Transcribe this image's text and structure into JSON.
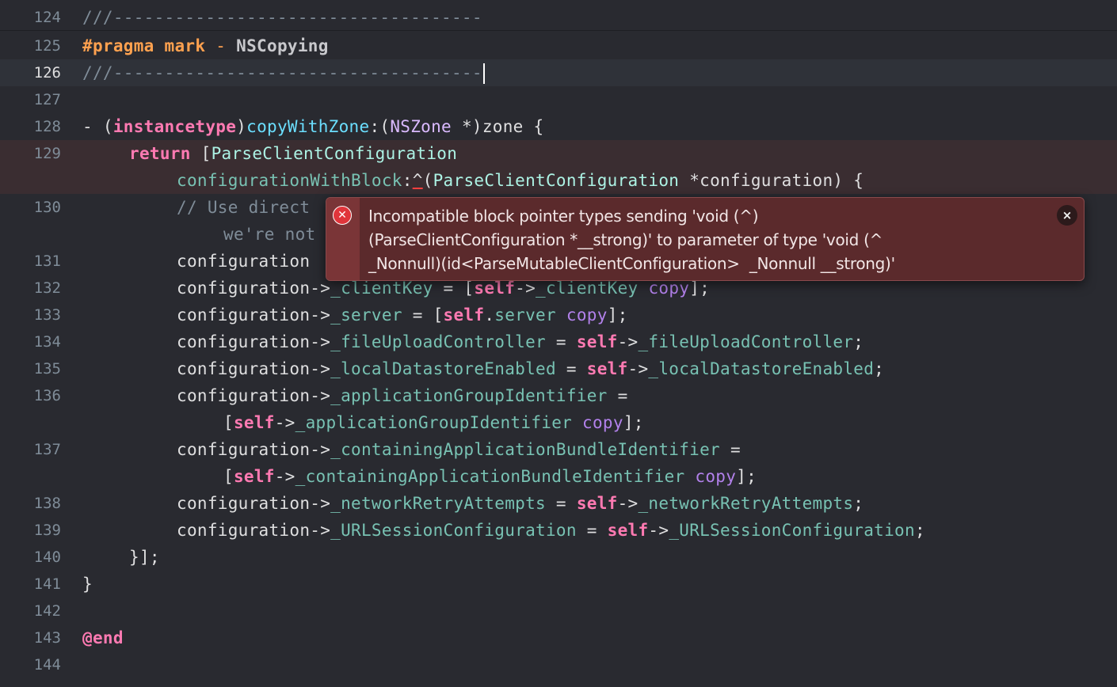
{
  "lines": {
    "l124": {
      "num": "124",
      "text": "///------------------------------------"
    },
    "l125": {
      "num": "125",
      "pragma": "#pragma mark",
      "dash": " - ",
      "mark": "NSCopying"
    },
    "l126": {
      "num": "126",
      "text": "///------------------------------------"
    },
    "l127": {
      "num": "127"
    },
    "l128": {
      "num": "128",
      "a": "- (",
      "b": "instancetype",
      "c": ")",
      "d": "copyWithZone",
      "e": ":(",
      "f": "NSZone",
      "g": " *)zone {"
    },
    "l129": {
      "num": "129",
      "a": "return",
      "b": " [",
      "c": "ParseClientConfiguration",
      "d": "configurationWithBlock",
      "e": ":",
      "f": "^",
      "g": "(",
      "h": "ParseClientConfiguration",
      "i": " *configuration) {"
    },
    "l130": {
      "num": "130",
      "a": "// Use direct",
      "b": "we're not"
    },
    "l131": {
      "num": "131",
      "a": "configuration"
    },
    "l132": {
      "num": "132",
      "a": "configuration->",
      "b": "_clientKey",
      "c": " = [",
      "d": "self",
      "e": "->",
      "f": "_clientKey",
      "g": " ",
      "h": "copy",
      "i": "];"
    },
    "l133": {
      "num": "133",
      "a": "configuration->",
      "b": "_server",
      "c": " = [",
      "d": "self",
      "e": ".",
      "f": "server",
      "g": " ",
      "h": "copy",
      "i": "];"
    },
    "l134": {
      "num": "134",
      "a": "configuration->",
      "b": "_fileUploadController",
      "c": " = ",
      "d": "self",
      "e": "->",
      "f": "_fileUploadController",
      "g": ";"
    },
    "l135": {
      "num": "135",
      "a": "configuration->",
      "b": "_localDatastoreEnabled",
      "c": " = ",
      "d": "self",
      "e": "->",
      "f": "_localDatastoreEnabled",
      "g": ";"
    },
    "l136": {
      "num": "136",
      "a": "configuration->",
      "b": "_applicationGroupIdentifier",
      "c": " =",
      "d": "[",
      "e": "self",
      "f": "->",
      "g": "_applicationGroupIdentifier",
      "h": " ",
      "i": "copy",
      "j": "];"
    },
    "l137": {
      "num": "137",
      "a": "configuration->",
      "b": "_containingApplicationBundleIdentifier",
      "c": " =",
      "d": "[",
      "e": "self",
      "f": "->",
      "g": "_containingApplicationBundleIdentifier",
      "h": " ",
      "i": "copy",
      "j": "];"
    },
    "l138": {
      "num": "138",
      "a": "configuration->",
      "b": "_networkRetryAttempts",
      "c": " = ",
      "d": "self",
      "e": "->",
      "f": "_networkRetryAttempts",
      "g": ";"
    },
    "l139": {
      "num": "139",
      "a": "configuration->",
      "b": "_URLSessionConfiguration",
      "c": " = ",
      "d": "self",
      "e": "->",
      "f": "_URLSessionConfiguration",
      "g": ";"
    },
    "l140": {
      "num": "140",
      "text": "}];"
    },
    "l141": {
      "num": "141",
      "text": "}"
    },
    "l142": {
      "num": "142"
    },
    "l143": {
      "num": "143",
      "text": "@end"
    },
    "l144": {
      "num": "144"
    }
  },
  "error": {
    "icon": "error-circle-icon",
    "line1": "Incompatible block pointer types sending 'void (^)",
    "line2": "(ParseClientConfiguration *__strong)' to parameter of type 'void (^",
    "line3": "_Nonnull)(id<ParseMutableClientConfiguration>  _Nonnull __strong)'",
    "close_label": "×"
  },
  "colors": {
    "background": "#292a30",
    "keyword": "#ff7ab2",
    "comment": "#7f8c98",
    "preprocessor": "#ffa14f",
    "type": "#dabaff",
    "function": "#6bdfff",
    "class": "#acf2e4",
    "member": "#78c2b3",
    "method": "#b281eb",
    "error_background": "#5b2a2c"
  }
}
